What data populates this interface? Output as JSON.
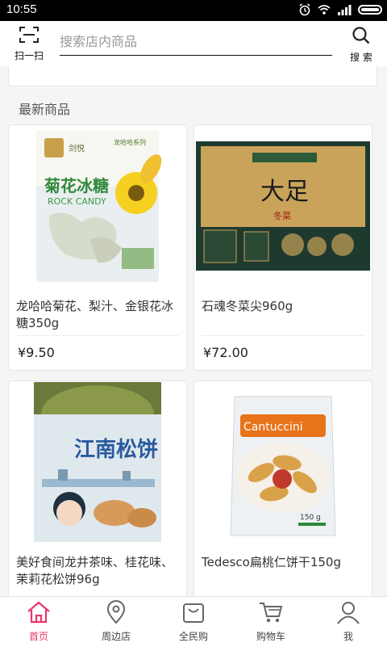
{
  "status": {
    "time": "10:55"
  },
  "header": {
    "scan_label": "扫一扫",
    "search_placeholder": "搜索店内商品",
    "search_label": "搜 索"
  },
  "section": {
    "title": "最新商品"
  },
  "products": [
    {
      "name": "龙哈哈菊花、梨汁、金银花冰糖350g",
      "price": "¥9.50",
      "image_text": {
        "brand": "剑悦",
        "series": "龙哈哈系列",
        "title": "菊花冰糖",
        "subtitle": "ROCK CANDY"
      }
    },
    {
      "name": "石魂冬菜尖960g",
      "price": "¥72.00",
      "image_text": {
        "title": "大足",
        "subtitle": "冬菜"
      }
    },
    {
      "name": "美好食间龙井茶味、桂花味、茉莉花松饼96g",
      "price": "",
      "image_text": {
        "title": "江南松饼"
      }
    },
    {
      "name": "Tedesco扁桃仁饼干150g",
      "price": "",
      "image_text": {
        "title": "Cantuccini",
        "weight": "150 g"
      }
    }
  ],
  "tabbar": {
    "items": [
      {
        "label": "首页",
        "icon": "home-icon",
        "active": true
      },
      {
        "label": "周边店",
        "icon": "location-pin-icon",
        "active": false
      },
      {
        "label": "全民购",
        "icon": "shopping-bag-icon",
        "active": false
      },
      {
        "label": "购物车",
        "icon": "cart-icon",
        "active": false
      },
      {
        "label": "我",
        "icon": "user-icon",
        "active": false
      }
    ]
  },
  "colors": {
    "accent": "#e8356a",
    "statusbar": "#000000"
  }
}
